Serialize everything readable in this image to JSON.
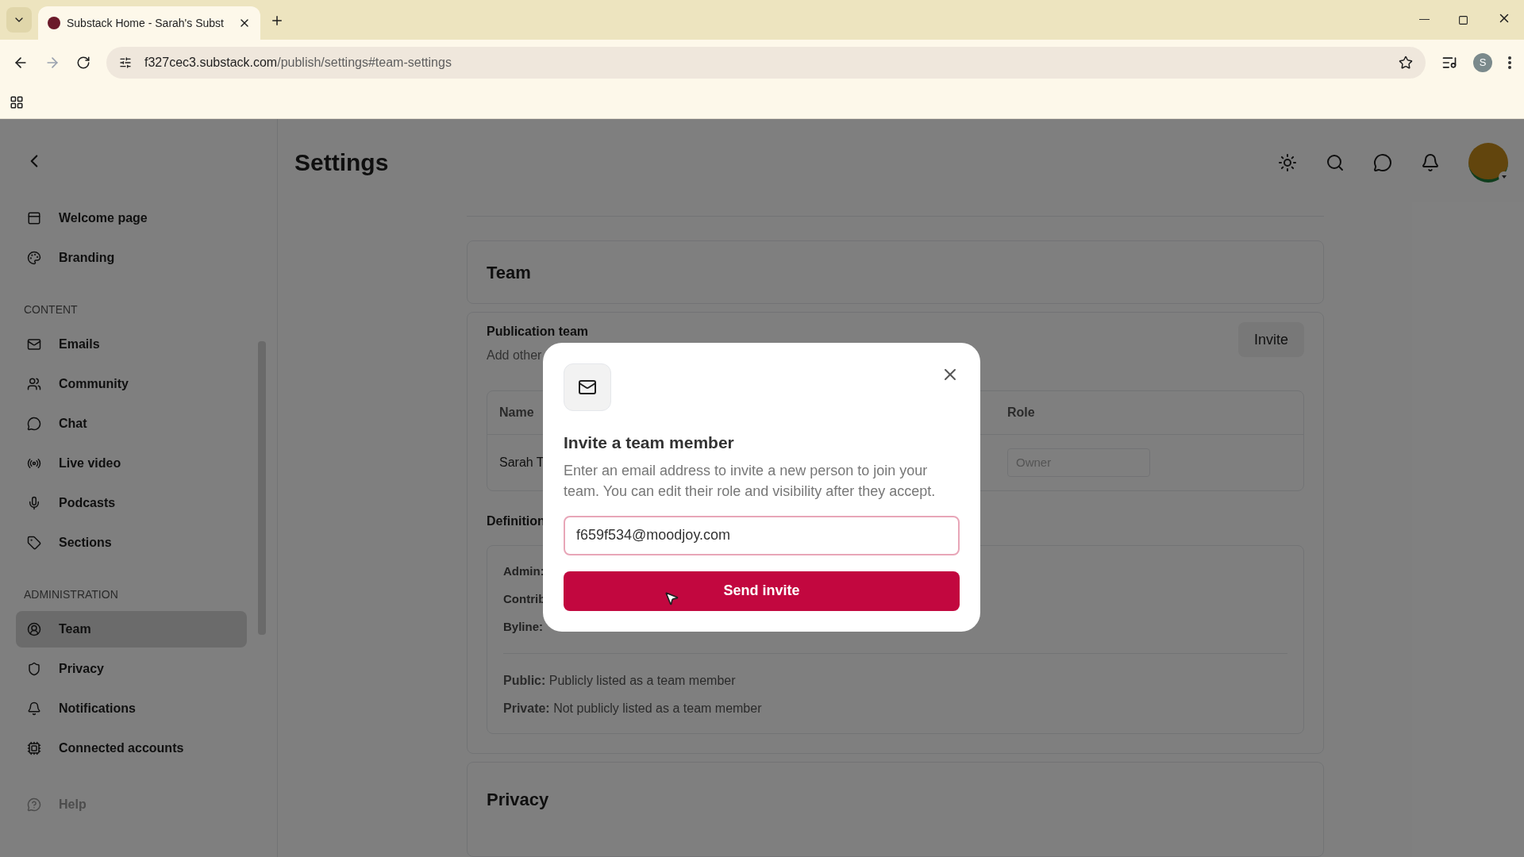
{
  "browser": {
    "tab_title": "Substack Home - Sarah's Subst",
    "url_host": "f327cec3.substack.com",
    "url_path": "/publish/settings#team-settings",
    "profile_initial": "S"
  },
  "sidebar": {
    "sections": [
      {
        "items": [
          {
            "label": "Welcome page",
            "selected": false
          },
          {
            "label": "Branding",
            "selected": false
          }
        ]
      },
      {
        "heading": "CONTENT",
        "items": [
          {
            "label": "Emails",
            "selected": false
          },
          {
            "label": "Community",
            "selected": false
          },
          {
            "label": "Chat",
            "selected": false
          },
          {
            "label": "Live video",
            "selected": false
          },
          {
            "label": "Podcasts",
            "selected": false
          },
          {
            "label": "Sections",
            "selected": false
          }
        ]
      },
      {
        "heading": "ADMINISTRATION",
        "items": [
          {
            "label": "Team",
            "selected": true
          },
          {
            "label": "Privacy",
            "selected": false
          },
          {
            "label": "Notifications",
            "selected": false
          },
          {
            "label": "Connected accounts",
            "selected": false
          }
        ]
      }
    ],
    "help": "Help"
  },
  "header": {
    "title": "Settings"
  },
  "team": {
    "title": "Team",
    "publication_team": "Publication team",
    "description": "Add other",
    "invite_button": "Invite",
    "table": {
      "columns": [
        "Name",
        "Role"
      ],
      "rows": [
        {
          "name": "Sarah T",
          "role": "Owner"
        }
      ]
    },
    "definitions_title": "Definition",
    "definitions": [
      "Admin:",
      "Contrib",
      "Byline:"
    ],
    "visibility": [
      "**Public:** Publicly listed as a team member",
      "**Private:** Not publicly listed as a team member"
    ]
  },
  "privacy": {
    "title": "Privacy"
  },
  "dialog": {
    "title": "Invite a team member",
    "description": "Enter an email address to invite a new person to join your team. You can edit their role and visibility after they accept.",
    "email_value": "f659f534@moodjoy.com",
    "send_button": "Send invite"
  }
}
